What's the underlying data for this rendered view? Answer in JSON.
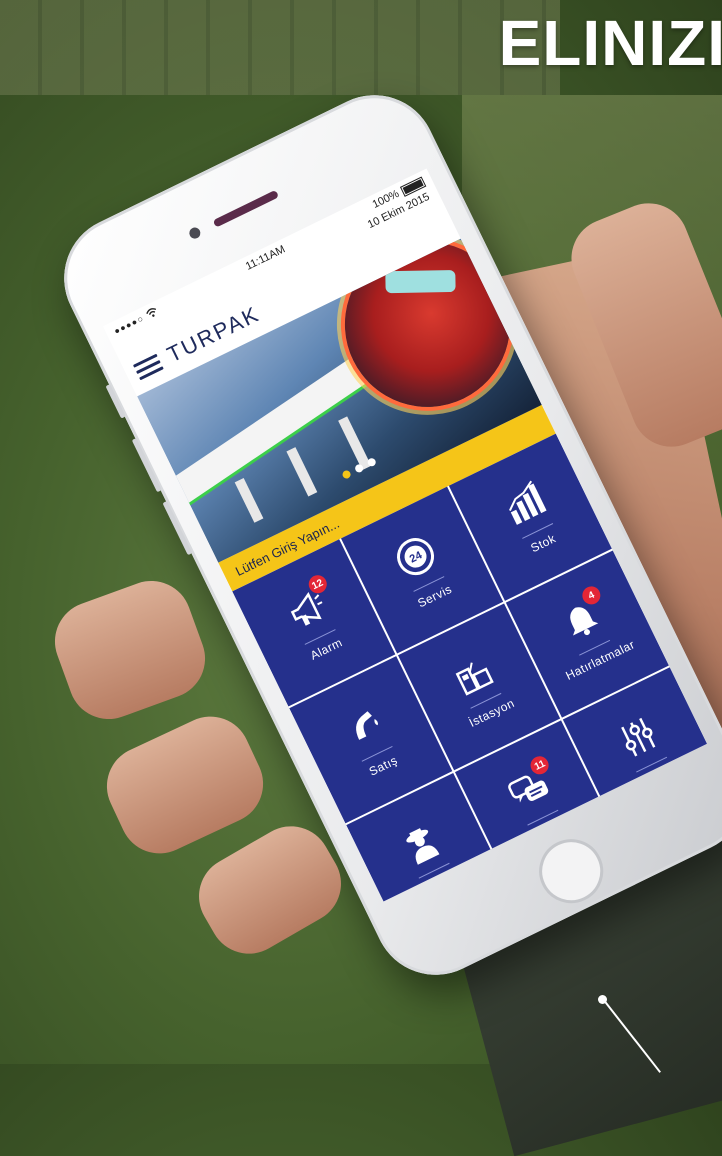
{
  "headline": "ELINIZI",
  "status_bar": {
    "signal_dots": "●●●●○",
    "wifi_icon": "wifi-icon",
    "time": "11:11AM",
    "battery_percent": "100%",
    "date": "10 Ekim 2015"
  },
  "appbar": {
    "menu_icon": "hamburger-menu-icon",
    "brand": "TURPAK"
  },
  "banner": {
    "slides": 3,
    "active_slide": 1
  },
  "login_prompt": "Lütfen Giriş Yapın...",
  "tiles": [
    {
      "id": "alarm",
      "label": "Alarm",
      "icon": "megaphone-icon",
      "glyph": "📢",
      "badge": "12"
    },
    {
      "id": "servis",
      "label": "Servis",
      "icon": "service-24-icon",
      "glyph": "⓸",
      "badge": ""
    },
    {
      "id": "stok",
      "label": "Stok",
      "icon": "bar-chart-icon",
      "glyph": "📶",
      "badge": ""
    },
    {
      "id": "satis",
      "label": "Satış",
      "icon": "fuel-nozzle-icon",
      "glyph": "⛽",
      "badge": ""
    },
    {
      "id": "istasyon",
      "label": "İstasyon",
      "icon": "station-pump-icon",
      "glyph": "🏪",
      "badge": ""
    },
    {
      "id": "hatirlatmalar",
      "label": "Hatırlatmalar",
      "icon": "bell-icon",
      "glyph": "🔔",
      "badge": "4"
    },
    {
      "id": "dedektif",
      "label": "Dedektif",
      "icon": "detective-icon",
      "glyph": "🕵",
      "badge": ""
    },
    {
      "id": "mesajlar",
      "label": "Mesajlar",
      "icon": "chat-bubbles-icon",
      "glyph": "💬",
      "badge": "11"
    },
    {
      "id": "ayarlar",
      "label": "Ayarlar",
      "icon": "sliders-icon",
      "glyph": "🎚",
      "badge": ""
    }
  ],
  "colors": {
    "tile_blue": "#25308c",
    "accent_yellow": "#f5c518",
    "badge_red": "#e32636",
    "brand_navy": "#1e2a5c"
  }
}
